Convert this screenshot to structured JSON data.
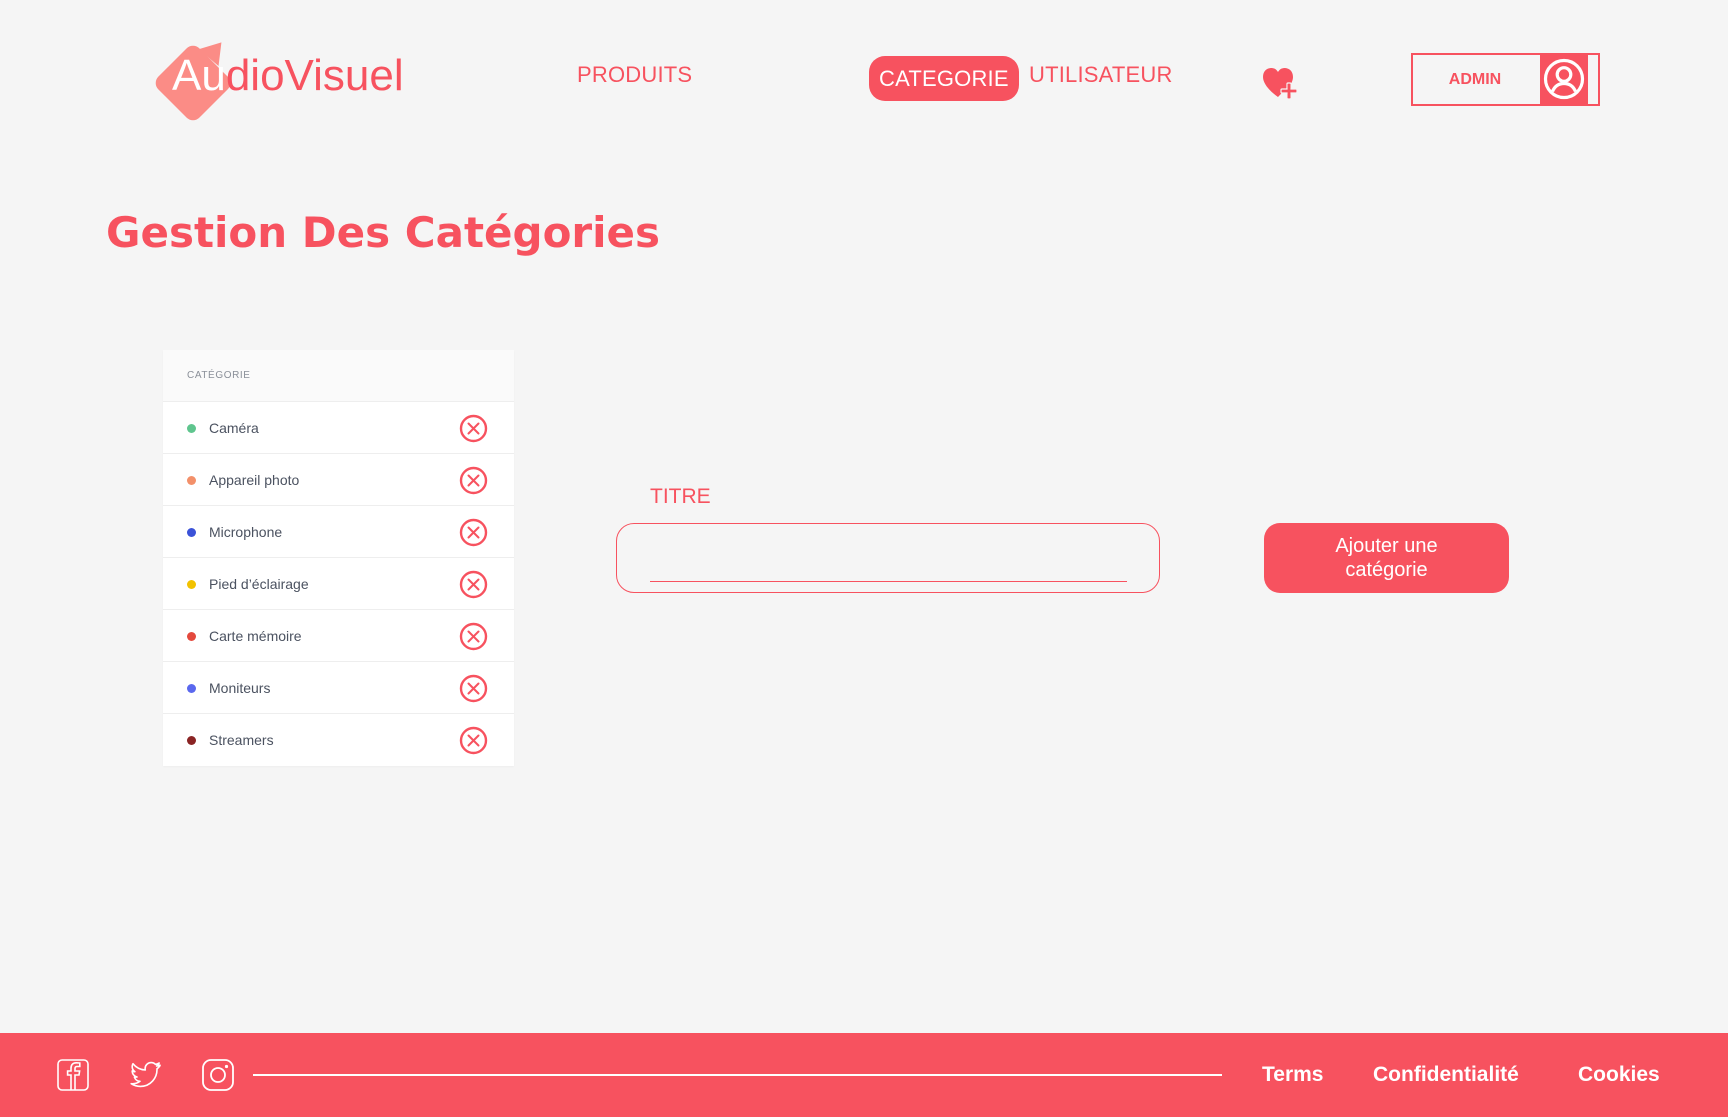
{
  "brand": {
    "logo_first": "Au",
    "logo_rest": "dioVisuel",
    "accent_color": "#f7525f"
  },
  "nav": {
    "items": [
      {
        "label": "PRODUITS"
      },
      {
        "label": "CATEGORIE",
        "active": true
      },
      {
        "label": "UTILISATEUR"
      }
    ],
    "wishlist_icon": "heart-plus-icon",
    "user": {
      "label": "ADMIN",
      "icon": "user-avatar-icon"
    }
  },
  "page": {
    "title": "Gestion Des Catégories"
  },
  "categories": {
    "header": "CATÉGORIE",
    "items": [
      {
        "label": "Caméra",
        "color": "#5fc58e"
      },
      {
        "label": "Appareil photo",
        "color": "#f3906a"
      },
      {
        "label": "Microphone",
        "color": "#3b52d8"
      },
      {
        "label": "Pied d’éclairage",
        "color": "#f2c200"
      },
      {
        "label": "Carte mémoire",
        "color": "#e4493d"
      },
      {
        "label": "Moniteurs",
        "color": "#5a68ee"
      },
      {
        "label": "Streamers",
        "color": "#8a2424"
      }
    ],
    "delete_icon": "close-circle-icon"
  },
  "form": {
    "titre_label": "TITRE",
    "titre_value": "",
    "submit_label": "Ajouter une catégorie"
  },
  "footer": {
    "social": [
      "facebook-icon",
      "twitter-icon",
      "instagram-icon"
    ],
    "links": [
      {
        "label": "Terms"
      },
      {
        "label": "Confidentialité"
      },
      {
        "label": "Cookies"
      }
    ]
  }
}
